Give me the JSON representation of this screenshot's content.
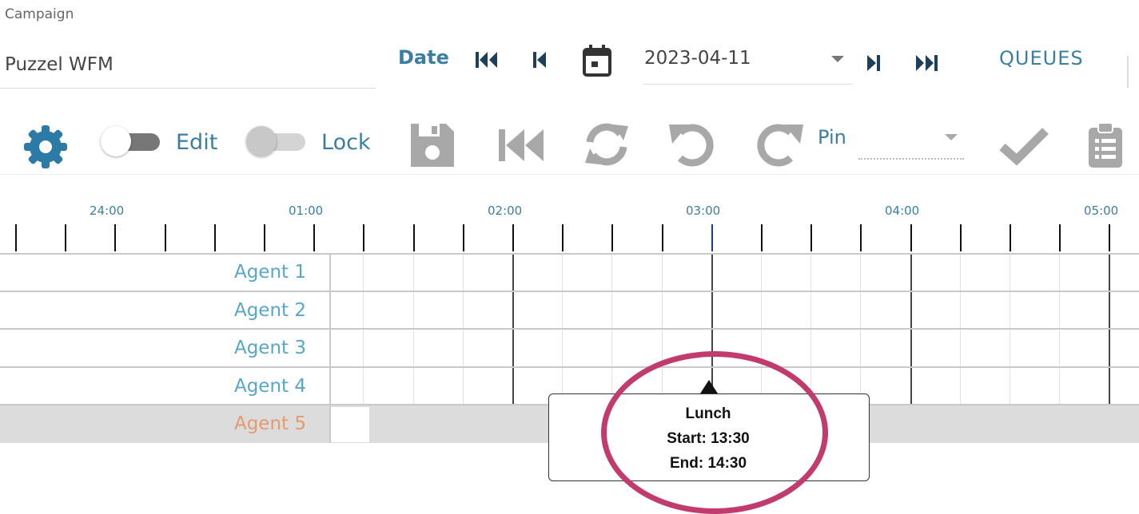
{
  "campaign": {
    "label": "Campaign",
    "value": "Puzzel WFM"
  },
  "date": {
    "label": "Date",
    "value": "2023-04-11"
  },
  "queues_label": "QUEUES",
  "toolbar": {
    "edit_label": "Edit",
    "lock_label": "Lock",
    "pin_label": "Pin"
  },
  "timeline": {
    "hours": [
      "24:00",
      "01:00",
      "02:00",
      "03:00",
      "04:00",
      "05:00"
    ]
  },
  "agents": [
    "Agent 1",
    "Agent 2",
    "Agent 3",
    "Agent 4",
    "Agent 5"
  ],
  "tooltip": {
    "title": "Lunch",
    "start": "Start: 13:30",
    "end": "End: 14:30"
  },
  "colors": {
    "accent": "#3a7fa3",
    "agent_name": "#57a7c7",
    "selected_agent": "#e6996e",
    "highlight_ring": "#c23b6e"
  }
}
